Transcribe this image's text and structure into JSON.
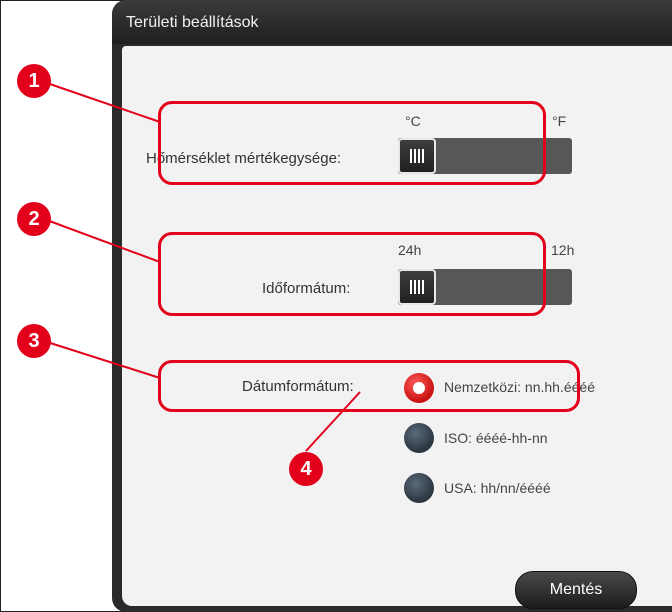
{
  "window": {
    "title": "Területi beállítások"
  },
  "temperature": {
    "label": "Hőmérséklet mértékegysége:",
    "option_left": "°C",
    "option_right": "°F",
    "selected": "°C"
  },
  "time_format": {
    "label": "Időformátum:",
    "option_left": "24h",
    "option_right": "12h",
    "selected": "24h"
  },
  "date_format": {
    "label": "Dátumformátum:",
    "options": [
      {
        "label": "Nemzetközi: nn.hh.éééé",
        "selected": true
      },
      {
        "label": "ISO: éééé-hh-nn",
        "selected": false
      },
      {
        "label": "USA: hh/nn/éééé",
        "selected": false
      }
    ]
  },
  "save_button": {
    "label": "Mentés"
  },
  "callouts": [
    "1",
    "2",
    "3",
    "4"
  ],
  "colors": {
    "highlight": "#e3001b",
    "panel": "#2a2a2a",
    "content": "#f2f2f2"
  }
}
